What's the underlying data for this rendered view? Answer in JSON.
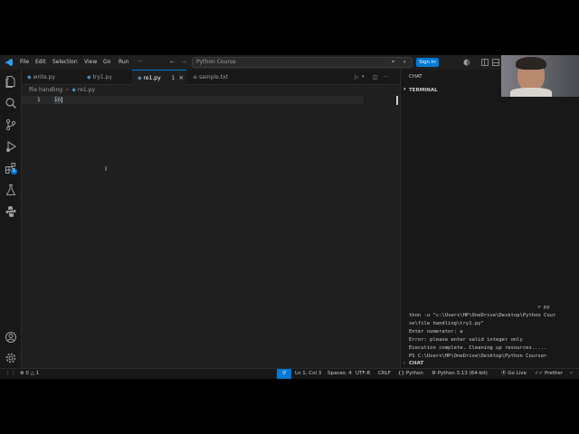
{
  "menu": [
    "File",
    "Edit",
    "Selection",
    "View",
    "Go",
    "Run",
    "···"
  ],
  "search": {
    "text": "Python Course"
  },
  "signin_label": "Sign In",
  "activity_badge": "1",
  "tabs": [
    {
      "label": "write.py",
      "icon": "python-file-icon"
    },
    {
      "label": "try1.py",
      "icon": "python-file-icon"
    },
    {
      "label": "re1.py",
      "icon": "python-file-icon",
      "badge": "1",
      "close": "×"
    },
    {
      "label": "sample.txt",
      "icon": "text-file-icon"
    }
  ],
  "breadcrumb": {
    "folder": "file handling",
    "sep": "›",
    "file": "re1.py"
  },
  "editor": {
    "line_number": "1",
    "line_text": "in"
  },
  "panel": {
    "chat_tab": "CHAT",
    "terminal_header": "TERMINAL",
    "chat_footer": "CHAT",
    "terminal_lines": [
      "                                           > py",
      "thon -u \"c:\\Users\\HP\\OneDrive\\Desktop\\Python Cour",
      "se\\file handling\\try1.py\"",
      "Enter numerator: a",
      "Error: please enter valid integer only",
      "Ececution complete. Cleaning up resources.....",
      "PS C:\\Users\\HP\\OneDrive\\Desktop\\Python Course> "
    ]
  },
  "status": {
    "errors": "0",
    "warnings": "1",
    "position": "Ln 1, Col 3",
    "spaces": "Spaces: 4",
    "encoding": "UTF-8",
    "eol": "CRLF",
    "language": "Python",
    "interpreter": "Python 3.13 (64-bit)",
    "golive": "Go Live",
    "prettier": "Prettier"
  },
  "colors": {
    "accent": "#0078d4",
    "status_highlight": "#0078d4"
  }
}
